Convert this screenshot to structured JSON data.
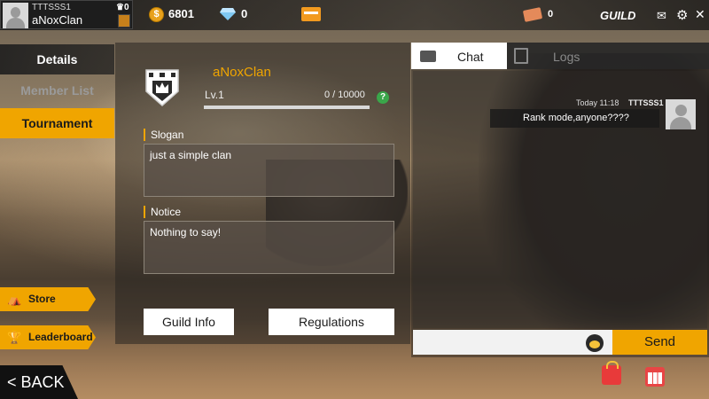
{
  "player": {
    "name": "TTTSSS1",
    "clan": "aNoxClan",
    "badge_count": "0"
  },
  "currency": {
    "coins": "6801",
    "diamonds": "0",
    "tickets": "0"
  },
  "header": {
    "title": "GUILD"
  },
  "menu": {
    "tabs": [
      {
        "label": "Details"
      },
      {
        "label": "Member List"
      },
      {
        "label": "Tournament"
      }
    ],
    "store": "Store",
    "leaderboard": "Leaderboard",
    "back": "BACK"
  },
  "guild": {
    "name": "aNoxClan",
    "level": "Lv.1",
    "xp": "0 / 10000",
    "xp_fraction": 0,
    "slogan_label": "Slogan",
    "slogan": "just a simple clan",
    "notice_label": "Notice",
    "notice": "Nothing to say!",
    "guild_info_button": "Guild Info",
    "regulations_button": "Regulations"
  },
  "chat": {
    "tabs": {
      "chat": "Chat",
      "logs": "Logs"
    },
    "messages": [
      {
        "time": "Today 11:18",
        "sender": "TTTSSS1",
        "text": "Rank mode,anyone????"
      }
    ],
    "input_value": "",
    "send_button": "Send"
  },
  "colors": {
    "accent": "#f0a500",
    "panel": "#282420"
  },
  "icons": [
    "avatar",
    "trophy-icon",
    "coin-icon",
    "diamond-icon",
    "card-icon",
    "ticket-icon",
    "mail-icon",
    "gear-icon",
    "close-icon",
    "emblem-icon",
    "help-icon",
    "chat-icon",
    "logs-icon",
    "store-icon",
    "leaderboard-icon",
    "emoji-icon",
    "shop-bag-icon",
    "calendar-icon"
  ]
}
